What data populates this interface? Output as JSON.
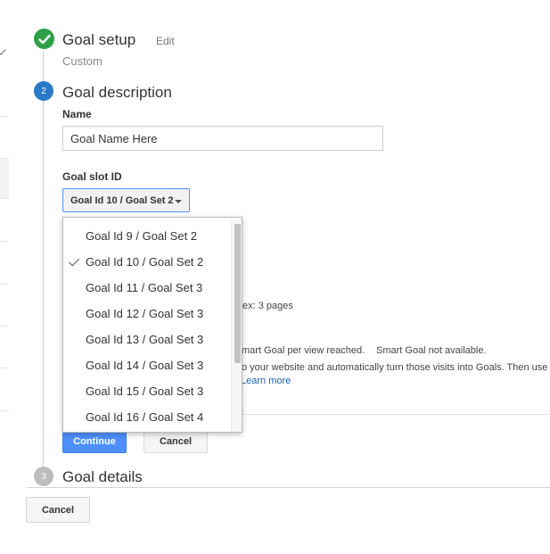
{
  "steps": {
    "setup": {
      "title": "Goal setup",
      "edit_label": "Edit",
      "subtitle": "Custom"
    },
    "description": {
      "number": "2",
      "title": "Goal description"
    },
    "details": {
      "number": "3",
      "title": "Goal details"
    }
  },
  "form": {
    "name_label": "Name",
    "name_value": "Goal Name Here",
    "slot_label": "Goal slot ID",
    "slot_selected": "Goal Id 10 / Goal Set 2"
  },
  "dropdown": {
    "items": [
      {
        "label": "Goal Id 9 / Goal Set 2"
      },
      {
        "label": "Goal Id 10 / Goal Set 2"
      },
      {
        "label": "Goal Id 11 / Goal Set 3"
      },
      {
        "label": "Goal Id 12 / Goal Set 3"
      },
      {
        "label": "Goal Id 13 / Goal Set 3"
      },
      {
        "label": "Goal Id 14 / Goal Set 3"
      },
      {
        "label": "Goal Id 15 / Goal Set 3"
      },
      {
        "label": "Goal Id 16 / Goal Set 4"
      }
    ]
  },
  "background": {
    "pages_text": "ex: 3 pages",
    "smart_goal_text": "mart Goal per view reached.",
    "smart_unavailable_text": "Smart Goal not available.",
    "visits_text": "o your website and automatically turn those visits into Goals. Then use",
    "learn_more": "Learn more"
  },
  "buttons": {
    "continue": "Continue",
    "cancel_inner": "Cancel",
    "cancel_outer": "Cancel"
  },
  "colors": {
    "done": "#2e9f47",
    "active": "#2a7ac8",
    "pending": "#bdbdbd",
    "primary_button": "#4d90fe"
  }
}
